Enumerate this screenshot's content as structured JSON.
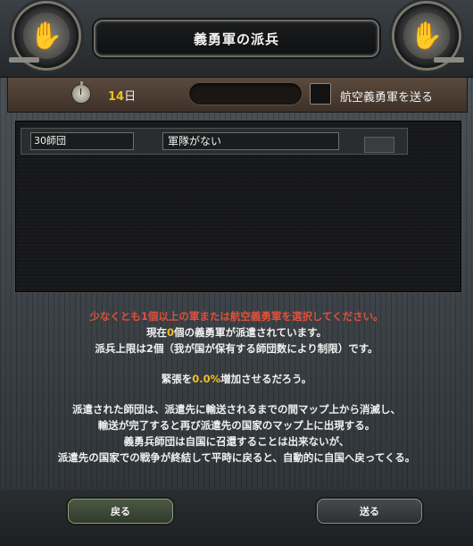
{
  "window": {
    "title": "義勇軍の派兵"
  },
  "header": {
    "left_emblem": "hand-emblem-icon",
    "right_emblem": "hand-emblem-icon"
  },
  "info": {
    "clock_icon": "stopwatch-icon",
    "days_value": "14",
    "days_unit": "日",
    "air_volunteer_label": "航空義勇軍を送る"
  },
  "list": {
    "rows": [
      {
        "division": "30師団",
        "army": "軍隊がない"
      }
    ]
  },
  "message": {
    "warning": "少なくとも1個以上の軍または航空義勇軍を選択してください。",
    "current_prefix": "現在",
    "current_count": "0",
    "current_suffix": "個の義勇軍が派遣されています。",
    "limit_prefix": "派兵上限は",
    "limit_count": "2",
    "limit_suffix": "個（我が国が保有する師団数により制限）です。",
    "tension_prefix": "緊張を",
    "tension_value": "0.0%",
    "tension_suffix": "増加させるだろう。",
    "line5": "派遣された師団は、派遣先に輸送されるまでの間マップ上から消滅し、",
    "line6": "輸送が完了すると再び派遣先の国家のマップ上に出現する。",
    "line7": "義勇兵師団は自国に召還することは出来ないが、",
    "line8": "派遣先の国家での戦争が終結して平時に戻ると、自動的に自国へ戻ってくる。"
  },
  "buttons": {
    "back_label": "戻る",
    "send_label": "送る"
  },
  "colors": {
    "accent_gold": "#f0c020",
    "warning_red": "#e0503a"
  }
}
